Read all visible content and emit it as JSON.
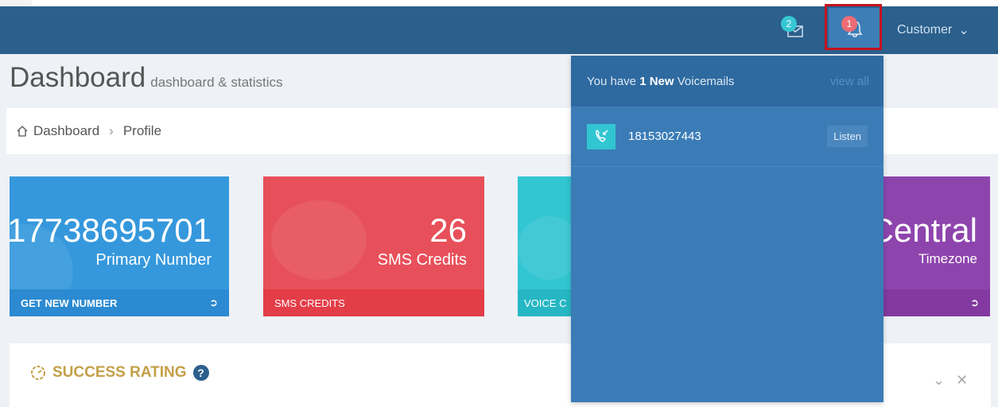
{
  "topbar": {
    "mail_badge": "2",
    "bell_badge": "1",
    "user_label": "Customer"
  },
  "page": {
    "title": "Dashboard",
    "subtitle": "dashboard & statistics"
  },
  "breadcrumb": {
    "home": "Dashboard",
    "current": "Profile"
  },
  "tiles": {
    "primary": {
      "number": "17738695701",
      "label": "Primary Number",
      "footer": "GET NEW NUMBER"
    },
    "sms": {
      "number": "26",
      "label": "SMS Credits",
      "footer": "SMS CREDITS"
    },
    "voice": {
      "footer": "VOICE C"
    },
    "timezone": {
      "number": "Central",
      "label": "Timezone"
    }
  },
  "portlet": {
    "title": "SUCCESS RATING"
  },
  "notifications": {
    "header_prefix": "You have ",
    "header_count": "1 New",
    "header_suffix": " Voicemails",
    "view_all": "view all",
    "items": [
      {
        "number": "18153027443",
        "action": "Listen"
      }
    ]
  },
  "icons": {
    "mail": "envelope-icon",
    "bell": "bell-icon",
    "home": "home-icon",
    "call": "incoming-call-icon",
    "arrow": "arrow-circle-right-icon",
    "speed": "speedometer-icon",
    "help": "question-circle-icon"
  },
  "colors": {
    "topbar": "#2b5f8c",
    "tile_blue": "#3598dc",
    "tile_red": "#e7505a",
    "tile_cyan": "#32c5d2",
    "tile_purple": "#8e44ad",
    "highlight": "#c3131f",
    "accent_gold": "#c49f47"
  }
}
